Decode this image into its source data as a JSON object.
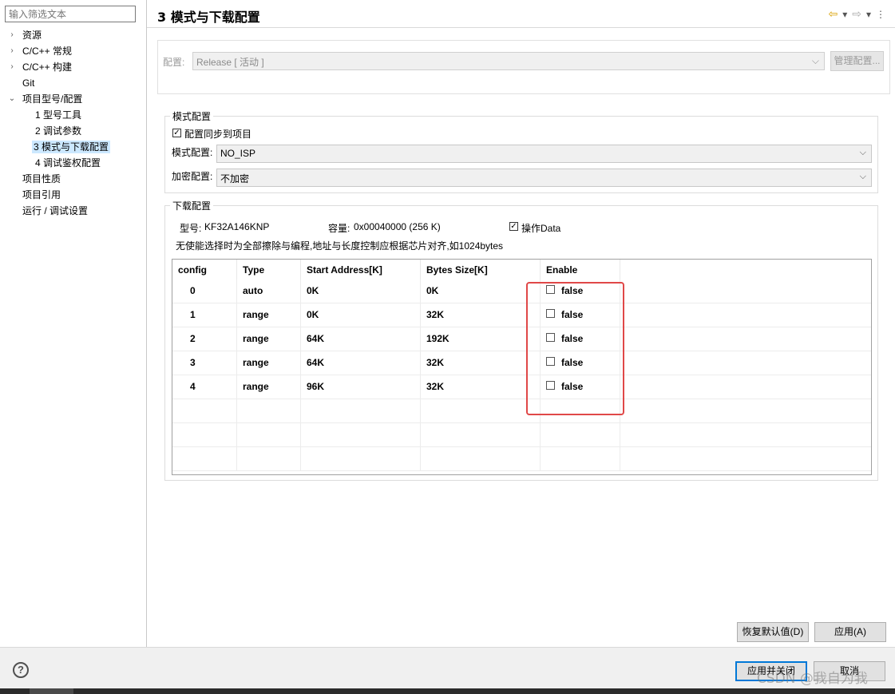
{
  "filter": {
    "placeholder": "输入筛选文本"
  },
  "tree": [
    {
      "label": "资源",
      "expander": "›"
    },
    {
      "label": "C/C++ 常规",
      "expander": "›"
    },
    {
      "label": "C/C++ 构建",
      "expander": "›"
    },
    {
      "label": "Git",
      "expander": ""
    },
    {
      "label": "项目型号/配置",
      "expander": "⌄"
    },
    {
      "label": "1 型号工具",
      "expander": ""
    },
    {
      "label": "2 调试参数",
      "expander": ""
    },
    {
      "label": "3 模式与下载配置",
      "expander": "",
      "selected": true
    },
    {
      "label": "4 调试鉴权配置",
      "expander": ""
    },
    {
      "label": "项目性质",
      "expander": ""
    },
    {
      "label": "项目引用",
      "expander": ""
    },
    {
      "label": "运行 / 调试设置",
      "expander": ""
    }
  ],
  "header": {
    "title": "3 模式与下载配置"
  },
  "config": {
    "label": "配置:",
    "value": "Release  [ 活动 ]",
    "manage_label": "管理配置..."
  },
  "mode_group": {
    "title": "模式配置",
    "sync_label": "配置同步到项目",
    "sync_checked": true,
    "mode_label": "模式配置:",
    "mode_value": "NO_ISP",
    "encrypt_label": "加密配置:",
    "encrypt_value": "不加密"
  },
  "download_group": {
    "title": "下载配置",
    "model_label": "型号:",
    "model_value": "KF32A146KNP",
    "capacity_label": "容量:",
    "capacity_value": "0x00040000 (256 K)",
    "data_label": "操作Data",
    "data_checked": true,
    "note": "无使能选择时为全部擦除与编程,地址与长度控制应根据芯片对齐,如1024bytes"
  },
  "table": {
    "columns": [
      "config",
      "Type",
      "Start Address[K]",
      "Bytes Size[K]",
      "Enable"
    ],
    "rows": [
      {
        "config": "0",
        "type": "auto",
        "start": "0K",
        "size": "0K",
        "enable": "false"
      },
      {
        "config": "1",
        "type": "range",
        "start": "0K",
        "size": "32K",
        "enable": "false"
      },
      {
        "config": "2",
        "type": "range",
        "start": "64K",
        "size": "192K",
        "enable": "false"
      },
      {
        "config": "3",
        "type": "range",
        "start": "64K",
        "size": "32K",
        "enable": "false"
      },
      {
        "config": "4",
        "type": "range",
        "start": "96K",
        "size": "32K",
        "enable": "false"
      }
    ]
  },
  "buttons": {
    "restore": "恢复默认值(D)",
    "apply": "应用(A)",
    "apply_close": "应用并关闭",
    "cancel": "取消"
  },
  "watermark": "CSDN @我自为我",
  "colors": {
    "highlight": "#e04848",
    "selection": "#cce8ff"
  }
}
